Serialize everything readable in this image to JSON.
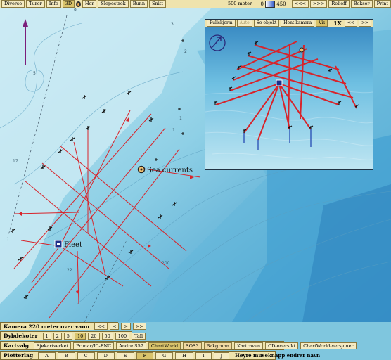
{
  "toolbar": {
    "items": [
      "Diverse",
      "Turer",
      "Info",
      "3D"
    ],
    "her": "Her",
    "items2": [
      "Slepestrek",
      "Bunn",
      "Snitt"
    ],
    "scale_label": "500 meter",
    "zero": "0",
    "depth_max": "450",
    "nav": [
      "<<<",
      ">>>"
    ],
    "right": [
      "Relieff",
      "Bokser",
      "Print"
    ]
  },
  "map": {
    "sea_currents": "Sea currents",
    "fleet": "Fleet",
    "depth_labels": [
      {
        "t": "8"
      },
      {
        "t": "2"
      },
      {
        "t": "3"
      },
      {
        "t": "1"
      },
      {
        "t": "1"
      },
      {
        "t": "5"
      },
      {
        "t": "17"
      },
      {
        "t": "22"
      },
      {
        "t": "200"
      }
    ]
  },
  "inset": {
    "buttons": [
      "Fullskjerm",
      "Auto",
      "Se objekt",
      "Hent kamera",
      "Vis"
    ],
    "zoom": "1X",
    "nav": [
      "<<",
      ">>"
    ]
  },
  "camera_panel": {
    "title": "Kamera 220 meter over vann",
    "buttons": [
      "<<",
      "<",
      ">",
      ">>"
    ]
  },
  "depth_panel": {
    "title": "Dybdekoter",
    "values": [
      "1",
      "2",
      "5",
      "10",
      "20",
      "50",
      "100",
      "Tall"
    ],
    "selected": "10"
  },
  "chart_panel": {
    "title": "Kartvalg",
    "options": [
      "Sjøkartverket",
      "Primar/IC-ENC",
      "Andre S57",
      "ChartWorld",
      "SOS3",
      "Bakgrunn",
      "Kartraven",
      "CD-oversikt",
      "ChartWorld-versjoner"
    ],
    "selected": "ChartWorld"
  },
  "plotter_panel": {
    "title": "Plotterlag",
    "layers": [
      "A",
      "B",
      "C",
      "D",
      "E",
      "F",
      "G",
      "H",
      "I",
      "J"
    ],
    "selected": "F",
    "note": "Høyre museknapp endrer navn"
  },
  "colors": {
    "route": "#d8232a",
    "panel": "#efe3ad",
    "sea_shallow": "#b7e1ef",
    "sea_deep": "#2f8fc6"
  }
}
